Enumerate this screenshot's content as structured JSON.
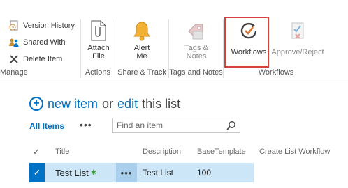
{
  "ribbon": {
    "manage": {
      "version_history": "Version History",
      "shared_with": "Shared With",
      "delete_item": "Delete Item",
      "label": "Manage"
    },
    "actions": {
      "attach_file_line1": "Attach",
      "attach_file_line2": "File",
      "label": "Actions"
    },
    "share_track": {
      "alert_me_line1": "Alert",
      "alert_me_line2": "Me",
      "label": "Share & Track"
    },
    "tags_notes": {
      "tags_line1": "Tags &",
      "tags_line2": "Notes",
      "label": "Tags and Notes"
    },
    "workflows": {
      "workflows": "Workflows",
      "approve_reject": "Approve/Reject",
      "label": "Workflows"
    }
  },
  "list": {
    "new_item": "new item",
    "or": "or",
    "edit": "edit",
    "this_list": "this list",
    "view_all_items": "All Items",
    "view_more": "•••",
    "search_placeholder": "Find an item"
  },
  "table": {
    "columns": [
      "Title",
      "Description",
      "BaseTemplate",
      "Create List Workflow"
    ],
    "rows": [
      {
        "title": "Test List",
        "new_marker": "✱",
        "menu": "•••",
        "description": "Test List",
        "base_template": "100",
        "create_list_workflow": ""
      }
    ]
  },
  "colors": {
    "accent": "#0072c6",
    "highlight_border": "#d9403a",
    "selected_row": "#cde6f7"
  },
  "icons": {
    "version_history": "version-history-icon",
    "shared_with": "shared-with-icon",
    "delete_item": "delete-x-icon",
    "attach_file": "attach-file-icon",
    "alert_me": "bell-icon",
    "tags_notes": "tag-icon",
    "workflows": "workflow-icon",
    "approve_reject": "approve-reject-icon",
    "search": "search-icon"
  }
}
